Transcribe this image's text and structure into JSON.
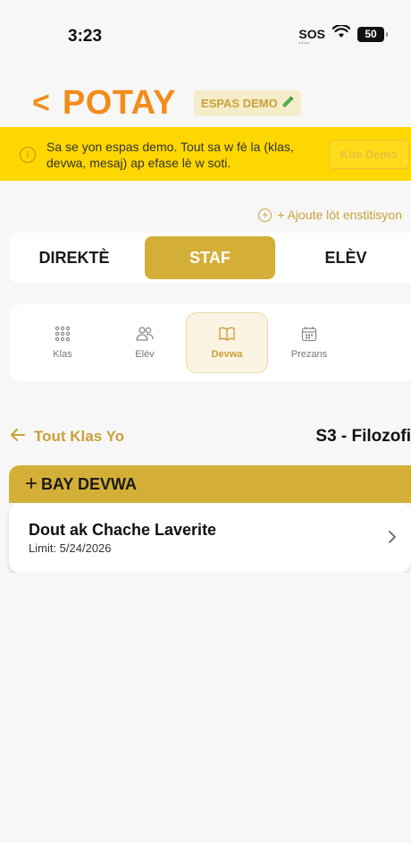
{
  "status_bar": {
    "time": "3:23",
    "sos": "SOS",
    "battery": "50"
  },
  "header": {
    "title": "POTAY",
    "badge": "ESPAS DEMO",
    "badge_icon": "test-tube-icon"
  },
  "banner": {
    "text": "Sa se yon espas demo. Tout sa w fè la (klas, devwa, mesaj) ap efase lè w soti.",
    "button": "Kite Demo"
  },
  "add_institution": "+ Ajoute lòt enstitisyon",
  "role_tabs": [
    {
      "label": "DIREKTÈ",
      "active": false
    },
    {
      "label": "STAF",
      "active": true
    },
    {
      "label": "ELÈV",
      "active": false
    }
  ],
  "nav": [
    {
      "label": "Klas",
      "icon": "grid-dots-icon",
      "active": false
    },
    {
      "label": "Elèv",
      "icon": "users-icon",
      "active": false
    },
    {
      "label": "Devwa",
      "icon": "book-icon",
      "active": true
    },
    {
      "label": "Prezans",
      "icon": "calendar-icon",
      "active": false
    }
  ],
  "breadcrumb": {
    "back_label": "Tout Klas Yo",
    "class_name": "S3 - Filozofi"
  },
  "assign_button": "BAY DEVWA",
  "homework": [
    {
      "title": "Dout ak Chache Laverite",
      "limit": "Limit: 5/24/2026"
    }
  ],
  "colors": {
    "accent_orange": "#F28C1B",
    "gold": "#D4AF37",
    "banner_yellow": "#FFD700"
  }
}
